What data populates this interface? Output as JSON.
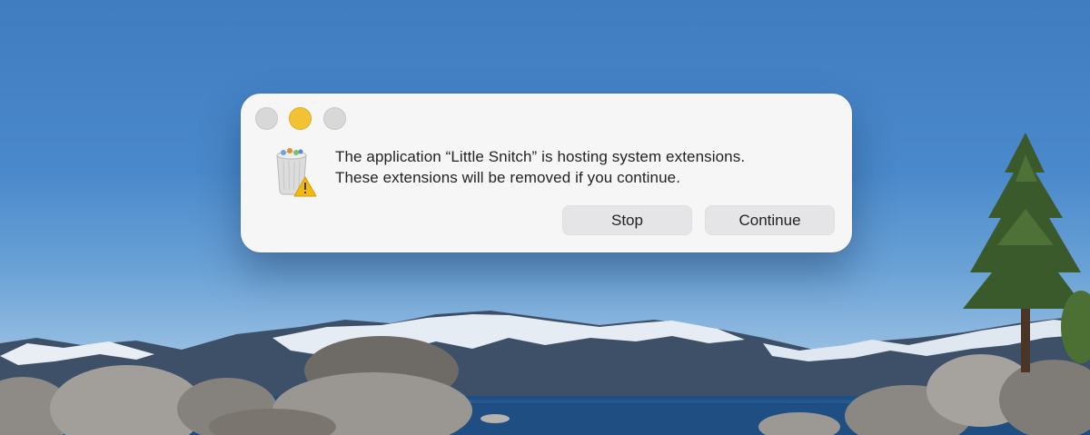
{
  "dialog": {
    "window_controls": {
      "close_icon": "close-icon",
      "minimize_icon": "minimize-icon",
      "zoom_icon": "zoom-icon"
    },
    "icon": "trash-warning-icon",
    "message_line1": "The application “Little Snitch” is hosting system extensions.",
    "message_line2": "These extensions will be removed if you continue.",
    "buttons": {
      "stop_label": "Stop",
      "continue_label": "Continue"
    }
  },
  "colors": {
    "minimize": "#f1c232",
    "inactive_control": "#d9d8d9",
    "dialog_background": "#f7f6f7",
    "button_background": "#e5e4e6",
    "warning": "#f2b90f"
  }
}
